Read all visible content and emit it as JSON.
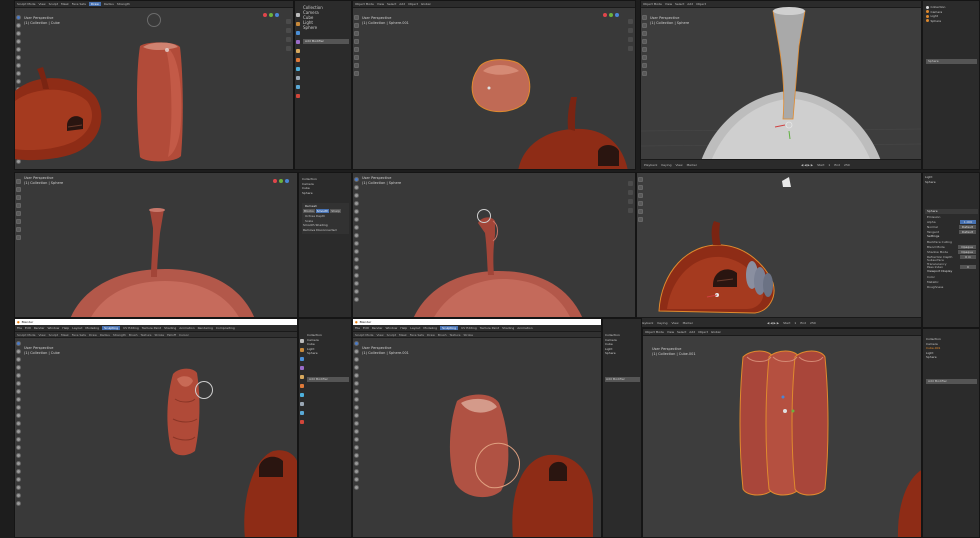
{
  "menu": {
    "sculpting": [
      "File",
      "Edit",
      "Render",
      "Window",
      "Help",
      "Layout",
      "Modeling",
      "Sculpting",
      "UV Editing",
      "Texture Paint",
      "Shading",
      "Animation",
      "Rendering",
      "Compositing",
      "Scripting"
    ],
    "layout": [
      "File",
      "Edit",
      "Render",
      "Window",
      "Help",
      "Layout",
      "Modeling",
      "Sculpting",
      "UV Editing"
    ],
    "active_tab": "Sculpting",
    "layout_active_tab": "Layout"
  },
  "sculpt_header": {
    "mode": "Sculpt Mode",
    "menus": [
      "View",
      "Sculpt",
      "Mask",
      "Face Sets"
    ],
    "brush": "Draw",
    "radius_label": "Radius",
    "strength_label": "Strength",
    "extras": [
      "Brush",
      "Texture",
      "Stroke",
      "Falloff",
      "Cursor"
    ]
  },
  "object_header": {
    "mode": "Object Mode",
    "menus": [
      "View",
      "Select",
      "Add",
      "Object"
    ],
    "orientation": "Global"
  },
  "viewport": {
    "perspective": "User Perspective",
    "collections": [
      "(1) Collection | Cube",
      "(1) Collection | Sphere.001",
      "(1) Collection | Sphere",
      "(1) Collection | Cube.001"
    ]
  },
  "outliner": {
    "title": "Scene Collection",
    "items": [
      "Collection",
      "Camera",
      "Cube",
      "Light",
      "Sphere",
      "Cube.001"
    ]
  },
  "modifier": {
    "add_label": "Add Modifier",
    "name": "Sphere",
    "settings": "Settings",
    "rows": [
      {
        "label": "Emission",
        "value": ""
      },
      {
        "label": "Alpha",
        "value": "1.000"
      },
      {
        "label": "Normal",
        "value": "Default"
      },
      {
        "label": "Tangent",
        "value": "Default"
      },
      {
        "label": "Blend Mode",
        "value": "Opaque"
      },
      {
        "label": "Shadow Mode",
        "value": "Opaque"
      },
      {
        "label": "Backface Culling",
        "value": ""
      },
      {
        "label": "Refraction Depth",
        "value": "0 m"
      },
      {
        "label": "Subsurface Translucency",
        "value": ""
      },
      {
        "label": "Pass Index",
        "value": "0"
      }
    ],
    "viewport_display": "Viewport Display",
    "color_label": "Color",
    "metallic_label": "Metallic",
    "roughness_label": "Roughness"
  },
  "remesh": {
    "title": "Remesh",
    "modes": [
      "Blocks",
      "Smooth",
      "Sharp",
      "Voxel"
    ],
    "octree_label": "Octree Depth",
    "scale_label": "Scale",
    "smooth_shading": "Smooth Shading",
    "remove_disconnected": "Remove Disconnected"
  },
  "timeline": {
    "items": [
      "Playback",
      "Keying",
      "View",
      "Marker"
    ],
    "start_label": "Start",
    "start": "1",
    "end_label": "End",
    "end": "250"
  },
  "window_title": "Blender",
  "colors": {
    "clay": "#b35a45",
    "dark_clay": "#8a2e1a",
    "grey_mesh": "#bdbdbd",
    "accent": "#4772b3",
    "selection_outline": "#e08a2e"
  },
  "icons": [
    "draw-brush-icon",
    "move-icon",
    "rotate-icon",
    "scale-icon",
    "camera-icon",
    "light-icon",
    "mesh-icon",
    "eye-icon",
    "wrench-icon",
    "material-icon"
  ]
}
